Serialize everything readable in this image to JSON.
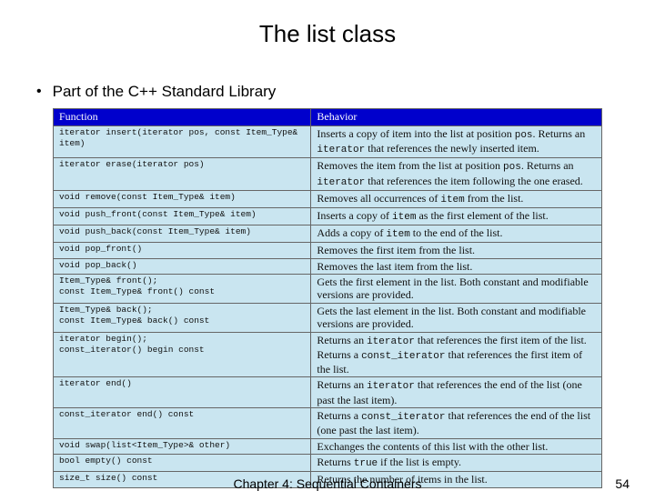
{
  "title": "The list class",
  "bullet": "Part of the C++ Standard Library",
  "headers": {
    "function": "Function",
    "behavior": "Behavior"
  },
  "rows": [
    {
      "fn": "iterator insert(iterator pos, const Item_Type& item)",
      "bh": "Inserts a copy of item into the list at position <span class=\"mono\">pos</span>. Returns an <span class=\"mono\">iterator</span> that references the newly inserted item."
    },
    {
      "fn": "iterator erase(iterator pos)",
      "bh": "Removes the item from the list at position <span class=\"mono\">pos</span>. Returns an <span class=\"mono\">iterator</span> that references the item following the one erased."
    },
    {
      "fn": "void remove(const Item_Type& item)",
      "bh": "Removes all occurrences of <span class=\"mono\">item</span> from the list."
    },
    {
      "fn": "void push_front(const Item_Type& item)",
      "bh": "Inserts a copy of <span class=\"mono\">item</span> as the first element of the list."
    },
    {
      "fn": "void push_back(const Item_Type& item)",
      "bh": "Adds a copy of <span class=\"mono\">item</span> to the end of the list."
    },
    {
      "fn": "void pop_front()",
      "bh": "Removes the first item from the list."
    },
    {
      "fn": "void pop_back()",
      "bh": "Removes the last item from the list."
    },
    {
      "fn": "Item_Type& front();\nconst Item_Type& front() const",
      "bh": "Gets the first element in the list. Both constant and modifiable versions are provided."
    },
    {
      "fn": "Item_Type& back();\nconst Item_Type& back() const",
      "bh": "Gets the last element in the list. Both constant and modifiable versions are provided."
    },
    {
      "fn": "iterator begin();\nconst_iterator() begin const",
      "bh": "Returns an <span class=\"mono\">iterator</span> that references the first item of the list. Returns a <span class=\"mono\">const_iterator</span> that references the first item of the list."
    },
    {
      "fn": "iterator end()",
      "bh": "Returns an <span class=\"mono\">iterator</span> that references the end of the list (one past the last item)."
    },
    {
      "fn": "const_iterator end() const",
      "bh": "Returns a <span class=\"mono\">const_iterator</span> that references the end of the list (one past the last item)."
    },
    {
      "fn": "void swap(list<Item_Type>& other)",
      "bh": "Exchanges the contents of this list with the other list."
    },
    {
      "fn": "bool empty() const",
      "bh": "Returns <span class=\"mono\">true</span> if the list is empty."
    },
    {
      "fn": "size_t size() const",
      "bh": "Returns the number of items in the list."
    }
  ],
  "footer": {
    "center": "Chapter 4: Sequential Containers",
    "page": "54"
  }
}
